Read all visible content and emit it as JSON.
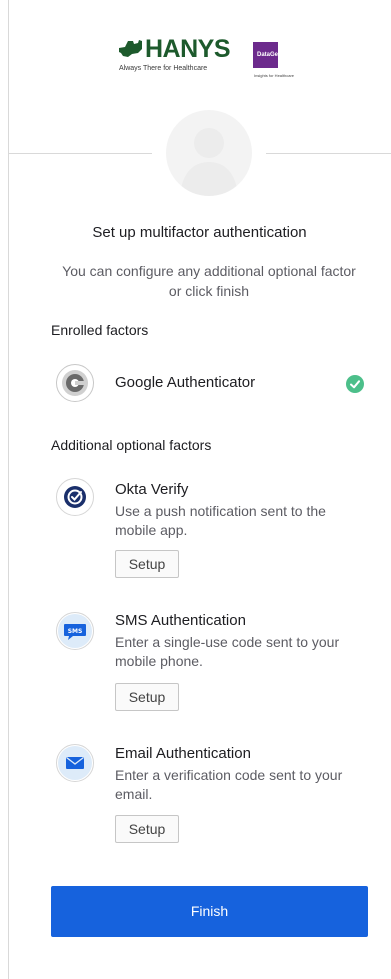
{
  "header": {
    "hanys_name": "HANYS",
    "hanys_tagline": "Always There for Healthcare",
    "datagen_name": "DataGen",
    "datagen_tagline": "Insights for Healthcare"
  },
  "title": "Set up multifactor authentication",
  "subtitle": "You can configure any additional optional factor or click finish",
  "enrolled": {
    "label": "Enrolled factors",
    "factors": [
      {
        "name": "Google Authenticator",
        "icon": "google-authenticator-icon",
        "status": "enrolled"
      }
    ]
  },
  "optional": {
    "label": "Additional optional factors",
    "factors": [
      {
        "name": "Okta Verify",
        "description": "Use a push notification sent to the mobile app.",
        "button": "Setup",
        "icon": "okta-verify-icon"
      },
      {
        "name": "SMS Authentication",
        "description": "Enter a single-use code sent to your mobile phone.",
        "button": "Setup",
        "icon": "sms-icon",
        "icon_text": "SMS"
      },
      {
        "name": "Email Authentication",
        "description": "Enter a verification code sent to your email.",
        "button": "Setup",
        "icon": "email-icon"
      }
    ]
  },
  "finish_label": "Finish",
  "colors": {
    "primary": "#1662dd",
    "success": "#4cbf8a",
    "hanys_green": "#1d5a2c",
    "datagen_purple": "#6c2a8c"
  }
}
